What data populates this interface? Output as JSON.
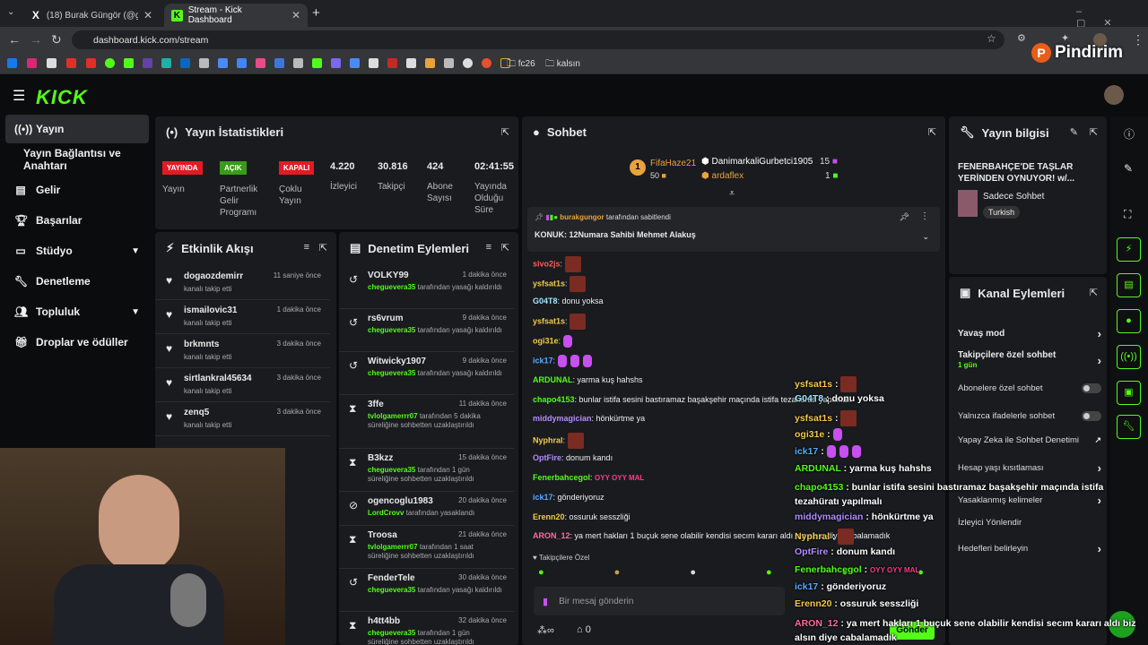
{
  "browser": {
    "tab1_title": "(18) Burak Güngör (@gungorbu",
    "tab2_title": "Stream - Kick Dashboard",
    "new_tab": "+",
    "url": "dashboard.kick.com/stream",
    "bookmark_folder1": "fc26",
    "bookmark_folder2": "kalsın"
  },
  "watermark": "Pindirim",
  "sidebar": {
    "items": [
      {
        "label": "Yayın",
        "icon": "stream-icon"
      },
      {
        "label": "Yayın Bağlantısı ve Anahtarı"
      },
      {
        "label": "Gelir",
        "icon": "chart-icon"
      },
      {
        "label": "Başarılar",
        "icon": "trophy-icon"
      },
      {
        "label": "Stüdyo",
        "icon": "studio-icon"
      },
      {
        "label": "Denetleme",
        "icon": "wrench-icon"
      },
      {
        "label": "Topluluk",
        "icon": "people-icon"
      },
      {
        "label": "Droplar ve ödüller",
        "icon": "gift-icon"
      }
    ]
  },
  "stats": {
    "title": "Yayın İstatistikleri",
    "badges": [
      {
        "badge": "YAYINDA",
        "label": "Yayın",
        "color": "#e01b24"
      },
      {
        "badge": "AÇIK",
        "label": "Partnerlik Gelir Programı",
        "color": "#3a9a1a"
      },
      {
        "badge": "KAPALI",
        "label": "Çoklu Yayın",
        "color": "#e01b24"
      }
    ],
    "numbers": [
      {
        "value": "4.220",
        "label": "İzleyici"
      },
      {
        "value": "30.816",
        "label": "Takipçi"
      },
      {
        "value": "424",
        "label": "Abone Sayısı"
      },
      {
        "value": "02:41:55",
        "label": "Yayında Olduğu Süre"
      }
    ]
  },
  "activity": {
    "title": "Etkinlik Akışı",
    "rows": [
      {
        "name": "dogaozdemirr",
        "sub": "kanalı takip etti",
        "time": "11 saniye önce"
      },
      {
        "name": "ismailovic31",
        "sub": "kanalı takip etti",
        "time": "1 dakika önce"
      },
      {
        "name": "brkmnts",
        "sub": "kanalı takip etti",
        "time": "3 dakika önce"
      },
      {
        "name": "sirtlankral45634",
        "sub": "kanalı takip etti",
        "time": "3 dakika önce"
      },
      {
        "name": "zenq5",
        "sub": "kanalı takip etti",
        "time": "3 dakika önce"
      }
    ]
  },
  "moderation": {
    "title": "Denetim Eylemleri",
    "rows": [
      {
        "name": "VOLKY99",
        "actor": "cheguevera35",
        "desc": "tarafından yasağı kaldırıldı",
        "time": "1 dakika önce",
        "icon": "undo-icon"
      },
      {
        "name": "rs6vrum",
        "actor": "cheguevera35",
        "desc": "tarafından yasağı kaldırıldı",
        "time": "9 dakika önce",
        "icon": "undo-icon"
      },
      {
        "name": "Witwicky1907",
        "actor": "cheguevera35",
        "desc": "tarafından yasağı kaldırıldı",
        "time": "9 dakika önce",
        "icon": "undo-icon"
      },
      {
        "name": "3ffe",
        "actor": "tvlolgamerrr07",
        "desc": "tarafından 5 dakika süreliğine sohbetten uzaklaştırıldı",
        "time": "11 dakika önce",
        "icon": "hourglass-icon"
      },
      {
        "name": "B3kzz",
        "actor": "cheguevera35",
        "desc": "tarafından 1 gün süreliğine sohbetten uzaklaştırıldı",
        "time": "15 dakika önce",
        "icon": "hourglass-icon"
      },
      {
        "name": "ogencoglu1983",
        "actor": "LordCrovv",
        "desc": "tarafından yasaklandı",
        "time": "20 dakika önce",
        "icon": "ban-icon"
      },
      {
        "name": "Troosa",
        "actor": "tvlolgamerrr07",
        "desc": "tarafından 1 saat süreliğine sohbetten uzaklaştırıldı",
        "time": "21 dakika önce",
        "icon": "hourglass-icon"
      },
      {
        "name": "FenderTele",
        "actor": "cheguevera35",
        "desc": "tarafından yasağı kaldırıldı",
        "time": "30 dakika önce",
        "icon": "undo-icon"
      },
      {
        "name": "h4tt4bb",
        "actor": "cheguevera35",
        "desc": "tarafından 1 gün süreliğine sohbetten uzaklaştırıldı",
        "time": "32 dakika önce",
        "icon": "hourglass-icon"
      }
    ]
  },
  "chat": {
    "title": "Sohbet",
    "top_gifter": {
      "rank": "1",
      "name": "FifaHaze21",
      "count": "50"
    },
    "second": {
      "name": "DanimarkaliGurbetci1905",
      "count": "15"
    },
    "third": {
      "name": "ardaflex",
      "count": "1"
    },
    "pinned_by": "burakgungor",
    "pinned_suffix": "tarafından sabitlendi",
    "pinned_text": "KONUK: 12Numara Sahibi Mehmet Alakuş",
    "messages": [
      {
        "user": "sivo2js",
        "color": "#ff5a5a",
        "text": ""
      },
      {
        "user": "ysfsat1s",
        "color": "#f2c94c",
        "text": ""
      },
      {
        "user": "G04T8",
        "color": "#9ee6ff",
        "text": "donu yoksa"
      },
      {
        "user": "ysfsat1s",
        "color": "#f2c94c",
        "text": ""
      },
      {
        "user": "ogi31e",
        "color": "#f2c94c",
        "text": ""
      },
      {
        "user": "ick17",
        "color": "#5aa9ff",
        "text": ""
      },
      {
        "user": "ARDUNAL",
        "color": "#53fc18",
        "text": "yarma kuş hahshs"
      },
      {
        "user": "chapo4153",
        "color": "#53fc18",
        "text": "bunlar istifa sesini bastıramaz başakşehir maçında istifa tezahüratı yapılmalı"
      },
      {
        "user": "middymagician",
        "color": "#b38cff",
        "text": "hönkürtme ya"
      },
      {
        "user": "Nyphral",
        "color": "#f2c94c",
        "text": ""
      },
      {
        "user": "OptFire",
        "color": "#b38cff",
        "text": "donum kandı"
      },
      {
        "user": "Fenerbahcegol",
        "color": "#53fc18",
        "text": ""
      },
      {
        "user": "ick17",
        "color": "#5aa9ff",
        "text": "gönderiyoruz"
      },
      {
        "user": "Erenn20",
        "color": "#f2c94c",
        "text": "ossuruk sesszliği"
      },
      {
        "user": "ARON_12",
        "color": "#ff6b9a",
        "text": "ya mert hakları 1 buçuk sene olabilir kendisi secım kararı aldı biz alsın diye cabalamadık"
      }
    ],
    "followers_only": "Takipçilere Özel",
    "placeholder": "Bir mesaj gönderin",
    "viewers_count": "0",
    "send": "Gönder"
  },
  "overlay_chat": [
    {
      "user": "ysfsat1s",
      "color": "#f2c94c",
      "text": ""
    },
    {
      "user": "G04T8",
      "color": "#9ee6ff",
      "text": "donu yoksa"
    },
    {
      "user": "ysfsat1s",
      "color": "#f2c94c",
      "text": ""
    },
    {
      "user": "ogi31e",
      "color": "#f2c94c",
      "text": ""
    },
    {
      "user": "ick17",
      "color": "#5aa9ff",
      "text": ""
    },
    {
      "user": "ARDUNAL",
      "color": "#53fc18",
      "text": "yarma kuş hahshs"
    },
    {
      "user": "chapo4153",
      "color": "#53fc18",
      "text": "bunlar istifa sesini bastıramaz başakşehir maçında istifa tezahüratı yapılmalı"
    },
    {
      "user": "middymagician",
      "color": "#b38cff",
      "text": "hönkürtme ya"
    },
    {
      "user": "Nyphral",
      "color": "#f2c94c",
      "text": ""
    },
    {
      "user": "OptFire",
      "color": "#b38cff",
      "text": "donum kandı"
    },
    {
      "user": "Fenerbahcegol",
      "color": "#53fc18",
      "text": ""
    },
    {
      "user": "ick17",
      "color": "#5aa9ff",
      "text": "gönderiyoruz"
    },
    {
      "user": "Erenn20",
      "color": "#f2c94c",
      "text": "ossuruk sesszliği"
    },
    {
      "user": "ARON_12",
      "color": "#ff6b9a",
      "text": "ya mert hakları 1 buçuk sene olabilir kendisi secım kararı aldı biz alsın diye cabalamadık"
    }
  ],
  "stream_info": {
    "title": "Yayın bilgisi",
    "stream_title": "FENERBAHÇE'DE TAŞLAR YERİNDEN OYNUYOR! w/...",
    "category": "Sadece Sohbet",
    "tag": "Turkish"
  },
  "channel_actions": {
    "title": "Kanal Eylemleri",
    "items": [
      {
        "label": "Yavaş mod",
        "type": "arrow"
      },
      {
        "label": "Takipçilere özel sohbet",
        "sub": "1 gün",
        "type": "arrow"
      },
      {
        "label": "Abonelere özel sohbet",
        "type": "toggle"
      },
      {
        "label": "Yalnızca ifadelerle sohbet",
        "type": "toggle"
      },
      {
        "label": "Yapay Zeka ile Sohbet Denetimi",
        "type": "link"
      },
      {
        "label": "Hesap yaşı kısıtlaması",
        "type": "arrow"
      },
      {
        "label": "Yasaklanmış kelimeler",
        "type": "arrow"
      },
      {
        "label": "İzleyici Yönlendir",
        "type": "none"
      },
      {
        "label": "Hedefleri belirleyin",
        "type": "arrow"
      }
    ]
  }
}
